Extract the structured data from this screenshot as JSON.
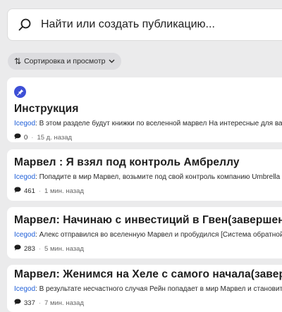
{
  "search": {
    "placeholder": "Найти или создать публикацию..."
  },
  "sort": {
    "label": "Сортировка и просмотр"
  },
  "posts": [
    {
      "pinned": true,
      "title": "Инструкция",
      "author": "Icegod",
      "excerpt": ": В этом разделе будут книжки по вселенной марвел На интересные для вас",
      "comments": "0",
      "time": "15 д. назад"
    },
    {
      "title": "Марвел : Я взял под контроль Амбреллу",
      "author": "Icegod",
      "excerpt": ": Попадите в мир Марвел, возьмите под свой контроль компанию Umbrella и",
      "comments": "461",
      "time": "1 мин. назад"
    },
    {
      "title": "Марвел: Начинаю с инвестиций в Гвен(завершена)",
      "author": "Icegod",
      "excerpt": ": Алекс отправился во вселенную Марвел и пробудился [Система обратной",
      "comments": "283",
      "time": "5 мин. назад"
    },
    {
      "title": "Марвел: Женимся на Хеле с самого начала(завершена)",
      "author": "Icegod",
      "excerpt": ": В результате несчастного случая Рейн попадает в мир Марвел и становитс",
      "comments": "337",
      "time": "7 мин. назад"
    }
  ],
  "colors": {
    "background": "#ebebec",
    "card": "#ffffff",
    "accent": "#3d4fd6",
    "author": "#1f5fd8"
  },
  "icons": {
    "search": "search-icon",
    "sort": "sort-arrows-icon",
    "chevron": "chevron-down-icon",
    "pin": "pin-icon",
    "comment": "comment-bubble-icon"
  }
}
